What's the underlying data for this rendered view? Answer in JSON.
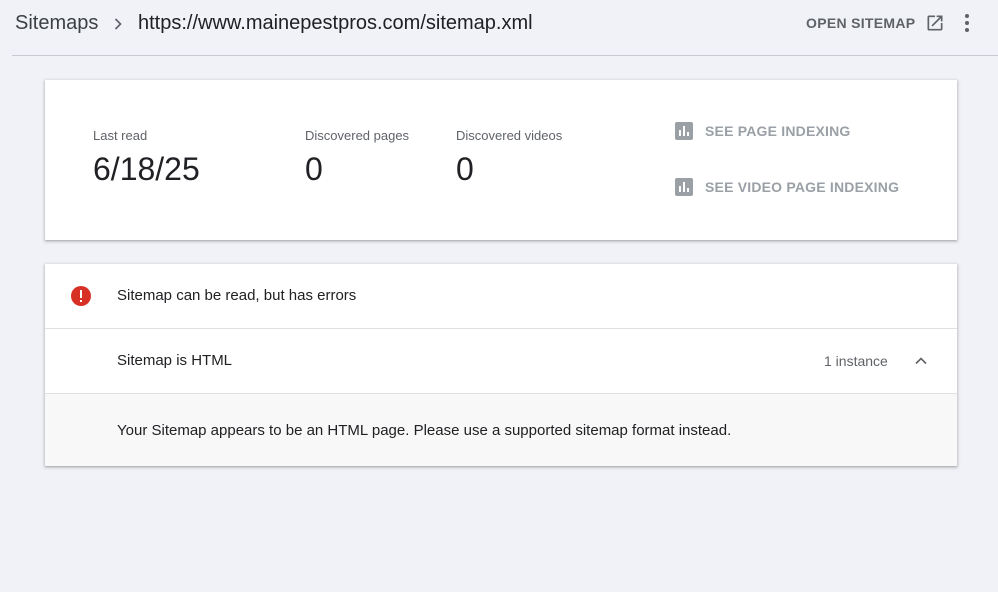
{
  "breadcrumb": {
    "root": "Sitemaps",
    "separator_icon": "chevron-right-icon",
    "current": "https://www.mainepestpros.com/sitemap.xml"
  },
  "header": {
    "open_sitemap_label": "OPEN SITEMAP",
    "open_icon": "open-in-new-icon",
    "more_icon": "more-vert-icon"
  },
  "stats": {
    "last_read": {
      "label": "Last read",
      "value": "6/18/25"
    },
    "discovered_pages": {
      "label": "Discovered pages",
      "value": "0"
    },
    "discovered_videos": {
      "label": "Discovered videos",
      "value": "0"
    },
    "links": [
      {
        "label": "SEE PAGE INDEXING",
        "icon": "bar-chart-icon"
      },
      {
        "label": "SEE VIDEO PAGE INDEXING",
        "icon": "bar-chart-icon"
      }
    ]
  },
  "issues": {
    "status_icon": "error-icon",
    "status_color": "#d93025",
    "title": "Sitemap can be read, but has errors",
    "items": [
      {
        "label": "Sitemap is HTML",
        "count": "1 instance",
        "expanded": true,
        "detail": "Your Sitemap appears to be an HTML page. Please use a supported sitemap format instead."
      }
    ]
  },
  "colors": {
    "page_background": "#f0f2f7",
    "card_background": "#ffffff",
    "disabled_link": "#9aa0a6",
    "error_red": "#d93025"
  }
}
